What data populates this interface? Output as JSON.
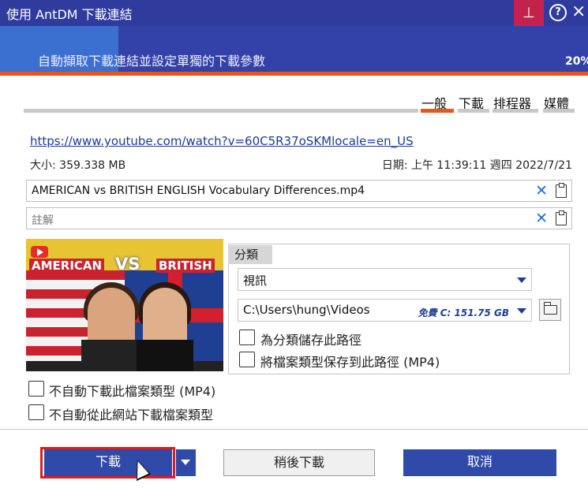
{
  "window": {
    "title": "使用 AntDM 下載連結",
    "subtitle": "自動擷取下載連結並設定單獨的下載參數",
    "progress_percent": "20%",
    "pin_icon": "pin-icon",
    "help_icon": "help-icon",
    "close_icon": "close-icon",
    "help_label": "?",
    "close_label": "×",
    "pin_label": "⊥"
  },
  "tabs": [
    {
      "label": "一般",
      "active": true
    },
    {
      "label": "下載",
      "active": false
    },
    {
      "label": "排程器",
      "active": false
    },
    {
      "label": "媒體",
      "active": false
    }
  ],
  "info": {
    "url": "https://www.youtube.com/watch?v=60C5R37oSKMlocale=en_US",
    "size": "大小: 359.338 MB",
    "date": "日期: 上午 11:39:11 週四 2022/7/21"
  },
  "filename_field": {
    "value": "AMERICAN vs BRITISH ENGLISH Vocabulary Differences.mp4"
  },
  "comment_field": {
    "placeholder": "註解"
  },
  "thumbnail": {
    "left_text": "AMERICAN",
    "vs_text": "VS",
    "right_text": "BRITISH"
  },
  "category": {
    "label": "分類",
    "selected": "視訊",
    "path": "C:\\Users\\hung\\Videos",
    "free_space": "免費 C: 151.75 GB",
    "save_path_label": "為分類儲存此路徑",
    "save_type_label": "將檔案類型保存到此路徑 (MP4)"
  },
  "options": {
    "no_auto_type": "不自動下載此檔案類型 (MP4)",
    "no_auto_site": "不自動從此網站下載檔案類型"
  },
  "buttons": {
    "download": "下載",
    "later": "稍後下載",
    "cancel": "取消"
  },
  "colors": {
    "header": "#2f3c9e",
    "accent": "#e8541e",
    "primary_button": "#2f4aa8",
    "highlight": "#e11b1b"
  }
}
